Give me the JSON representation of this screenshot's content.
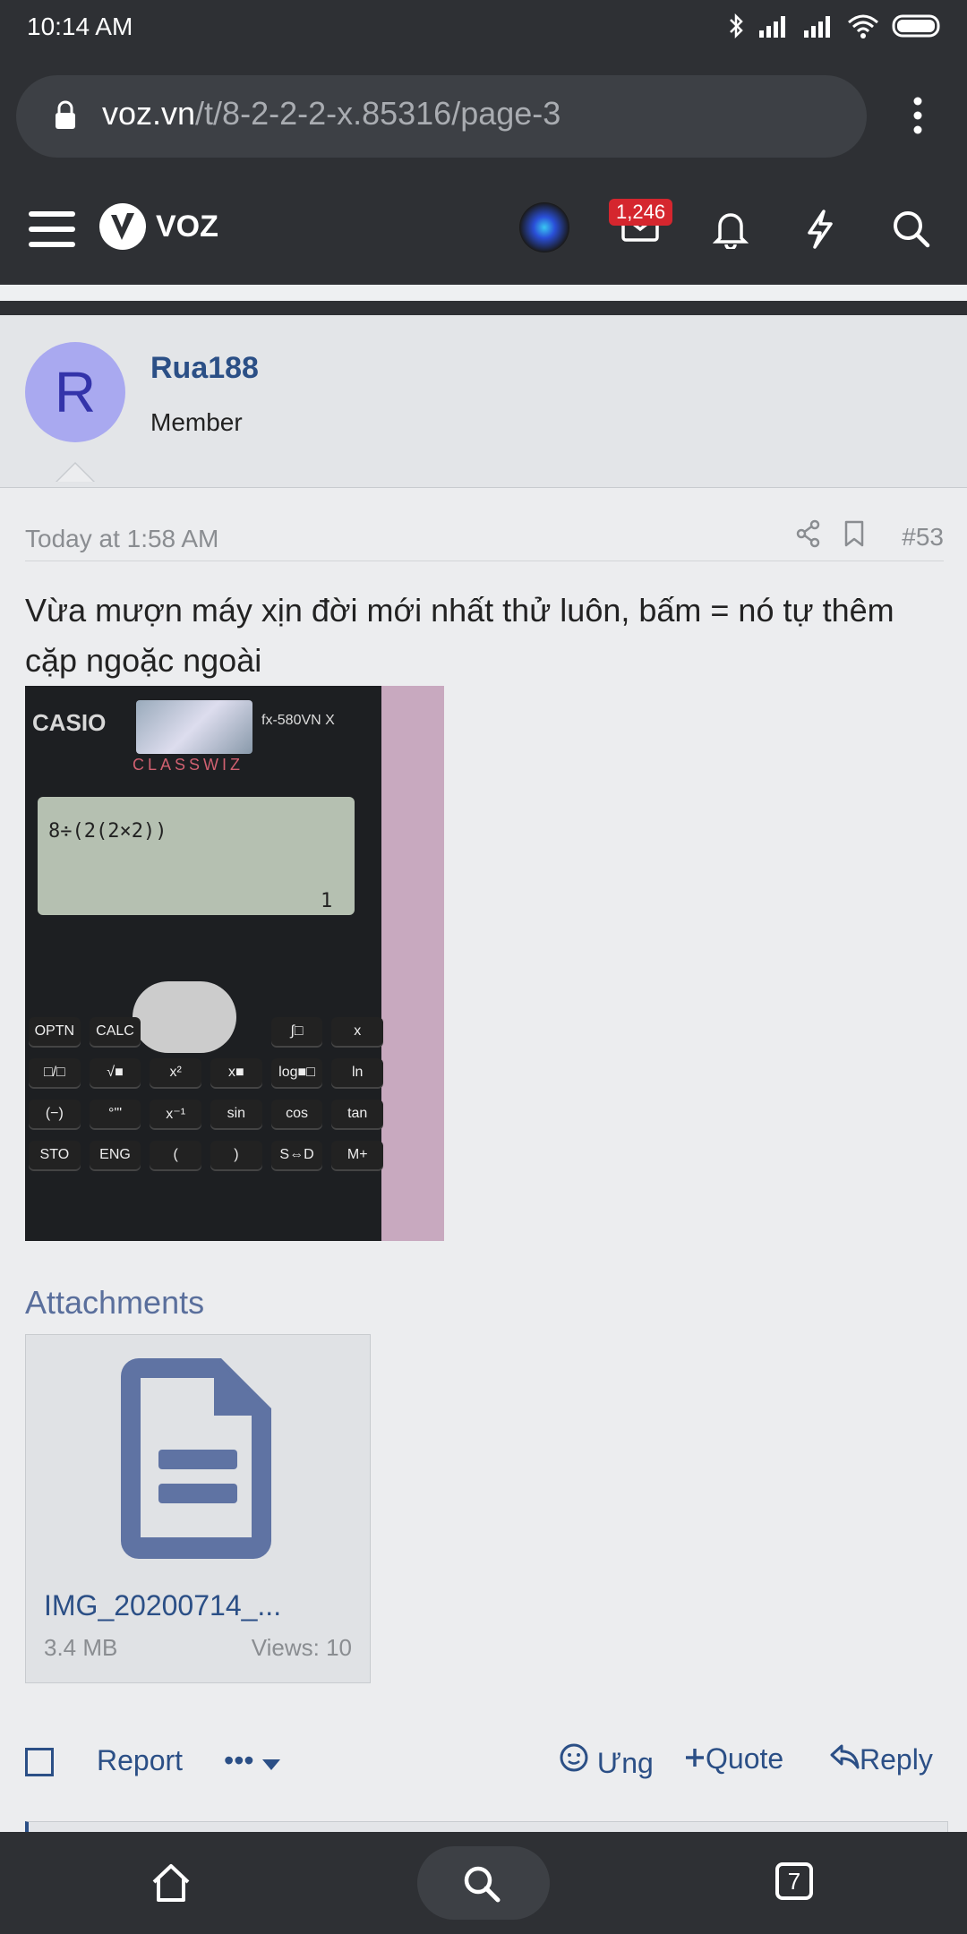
{
  "status_bar": {
    "time": "10:14 AM"
  },
  "browser": {
    "url_domain": "voz.vn",
    "url_path": "/t/8-2-2-2-x.85316/page-3"
  },
  "site_nav": {
    "logo_text": "VOZ",
    "message_badge": "1,246"
  },
  "post": {
    "user_initial": "R",
    "username": "Rua188",
    "role": "Member",
    "date": "Today at 1:58 AM",
    "post_number": "#53",
    "body_text": "Vừa mượn máy xịn đời mới nhất thử luôn, bấm = nó tự thêm cặp ngoặc ngoài",
    "photo": {
      "brand": "CASIO",
      "model": "fx-580VN X",
      "series": "CLASSWIZ",
      "expression": "8÷(2(2×2))",
      "result": "1",
      "keys": [
        [
          "OPTN",
          "CALC",
          "∫□",
          "x"
        ],
        [
          "□/□",
          "√■",
          "x²",
          "x■",
          "log■□",
          "ln"
        ],
        [
          "(−)",
          "°'\"",
          "x⁻¹",
          "sin",
          "cos",
          "tan"
        ],
        [
          "STO",
          "ENG",
          "(",
          ")",
          "S⇔D",
          "M+"
        ]
      ]
    },
    "attachments_title": "Attachments",
    "attachment": {
      "filename": "IMG_20200714_...",
      "size": "3.4 MB",
      "views": "Views: 10"
    },
    "actions": {
      "report": "Report",
      "more": "•••",
      "react": "Ưng",
      "quote": "Quote",
      "reply": "Reply"
    }
  },
  "bottom_nav": {
    "tab_count": "7"
  }
}
